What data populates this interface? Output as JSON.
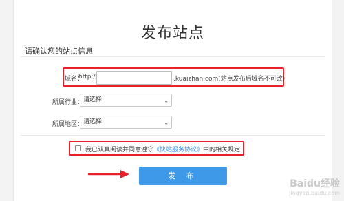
{
  "header": {
    "title": "发布站点",
    "subtitle": "请确认您的站点信息"
  },
  "form": {
    "domain_label": "域名：",
    "domain_prefix": "http://",
    "domain_value": "",
    "domain_suffix": ".kuaizhan.com(站点发布后域名不可改)",
    "industry_label": "所属行业：",
    "industry_selected": "请选择",
    "region_label": "所属地区：",
    "region_selected": "请选择"
  },
  "agreement": {
    "text_before": "我已认真阅读并同意遵守",
    "link": "《快站服务协议》",
    "text_after": "中的相关规定",
    "checked": false
  },
  "actions": {
    "publish_label": "发 布"
  },
  "annotations": {
    "highlight_color": "#e8212b",
    "accent_color": "#3e9ae8"
  },
  "watermark": {
    "brand": "Baidu经验",
    "url": "jingyan.baidu.com"
  }
}
